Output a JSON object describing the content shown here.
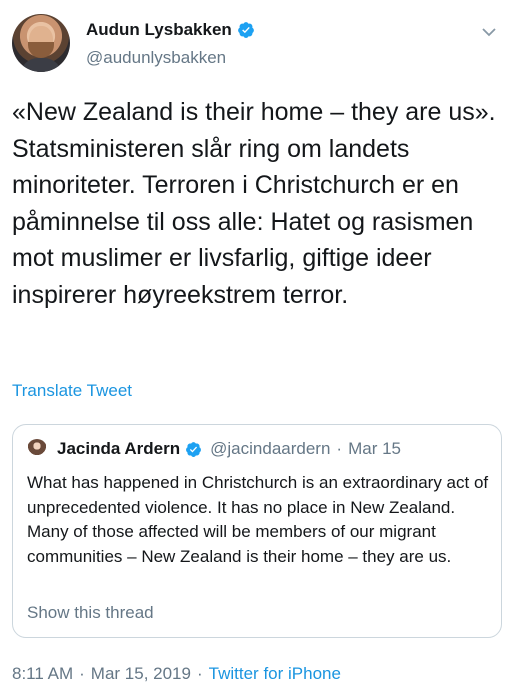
{
  "author": {
    "display_name": "Audun Lysbakken",
    "handle": "@audunlysbakken",
    "verified_icon": "verified-badge-icon"
  },
  "tweet": {
    "text": "«New Zealand is their home – they are us». Statsministeren slår ring om landets minoriteter. Terroren i Christchurch er en påminnelse til oss alle: Hatet og rasismen mot muslimer er livsfarlig, giftige ideer inspirerer høyreekstrem terror.",
    "translate_label": "Translate Tweet"
  },
  "quoted": {
    "display_name": "Jacinda Ardern",
    "handle": "@jacindaardern",
    "separator": "·",
    "date": "Mar 15",
    "text": "What has happened in Christchurch is an extraordinary act of unprecedented violence. It has no place in New Zealand. Many of those affected will be members of our migrant communities – New Zealand is their home – they are us.",
    "show_thread_label": "Show this thread"
  },
  "meta": {
    "time": "8:11 AM",
    "separator": "·",
    "date": "Mar 15, 2019",
    "source": "Twitter for iPhone"
  },
  "colors": {
    "link_blue": "#1b95e0",
    "secondary_text": "#657786",
    "primary_text": "#14171a",
    "border": "#ccd6dd"
  }
}
